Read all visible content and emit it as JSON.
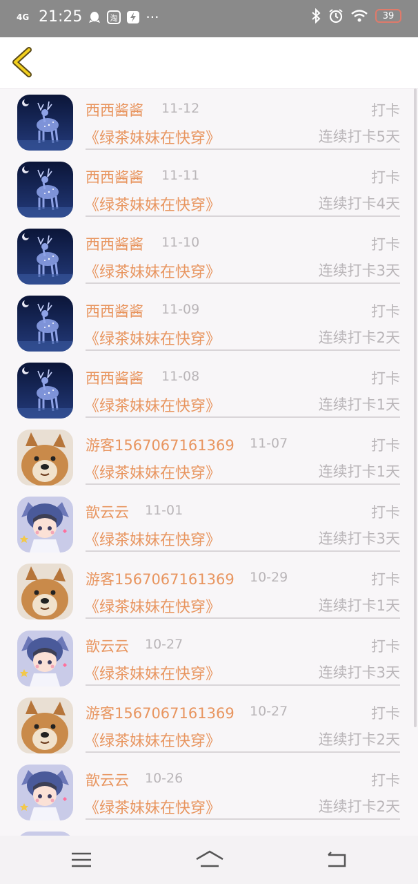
{
  "status_bar": {
    "signal": "4G",
    "time": "21:25",
    "app_icons": [
      "qq-icon",
      "taobao-icon",
      "flash-icon"
    ],
    "more": "···",
    "battery": "39",
    "colors": {
      "background": "#8a8a8a",
      "battery_ring": "#e07a6a"
    }
  },
  "header": {
    "back_icon": "chevron-left-icon",
    "back_color": "#e8b800"
  },
  "theme": {
    "accent": "#e8955f",
    "muted": "#b9b5b8"
  },
  "records": [
    {
      "avatar": "deer",
      "name": "西西酱酱",
      "date": "11-12",
      "action": "打卡",
      "book": "《绿茶妹妹在快穿》",
      "streak": "连续打卡5天"
    },
    {
      "avatar": "deer",
      "name": "西西酱酱",
      "date": "11-11",
      "action": "打卡",
      "book": "《绿茶妹妹在快穿》",
      "streak": "连续打卡4天"
    },
    {
      "avatar": "deer",
      "name": "西西酱酱",
      "date": "11-10",
      "action": "打卡",
      "book": "《绿茶妹妹在快穿》",
      "streak": "连续打卡3天"
    },
    {
      "avatar": "deer",
      "name": "西西酱酱",
      "date": "11-09",
      "action": "打卡",
      "book": "《绿茶妹妹在快穿》",
      "streak": "连续打卡2天"
    },
    {
      "avatar": "deer",
      "name": "西西酱酱",
      "date": "11-08",
      "action": "打卡",
      "book": "《绿茶妹妹在快穿》",
      "streak": "连续打卡1天"
    },
    {
      "avatar": "dog",
      "name": "游客1567067161369",
      "date": "11-07",
      "action": "打卡",
      "book": "《绿茶妹妹在快穿》",
      "streak": "连续打卡1天"
    },
    {
      "avatar": "girl",
      "name": "歆云云",
      "date": "11-01",
      "action": "打卡",
      "book": "《绿茶妹妹在快穿》",
      "streak": "连续打卡3天"
    },
    {
      "avatar": "dog",
      "name": "游客1567067161369",
      "date": "10-29",
      "action": "打卡",
      "book": "《绿茶妹妹在快穿》",
      "streak": "连续打卡1天"
    },
    {
      "avatar": "girl",
      "name": "歆云云",
      "date": "10-27",
      "action": "打卡",
      "book": "《绿茶妹妹在快穿》",
      "streak": "连续打卡3天"
    },
    {
      "avatar": "dog",
      "name": "游客1567067161369",
      "date": "10-27",
      "action": "打卡",
      "book": "《绿茶妹妹在快穿》",
      "streak": "连续打卡2天"
    },
    {
      "avatar": "girl",
      "name": "歆云云",
      "date": "10-26",
      "action": "打卡",
      "book": "《绿茶妹妹在快穿》",
      "streak": "连续打卡2天"
    },
    {
      "avatar": "girl",
      "name": "",
      "date": "",
      "action": "",
      "book": "",
      "streak": ""
    }
  ],
  "nav_bar": {
    "icons": [
      "menu-icon",
      "home-icon",
      "back-icon"
    ]
  }
}
